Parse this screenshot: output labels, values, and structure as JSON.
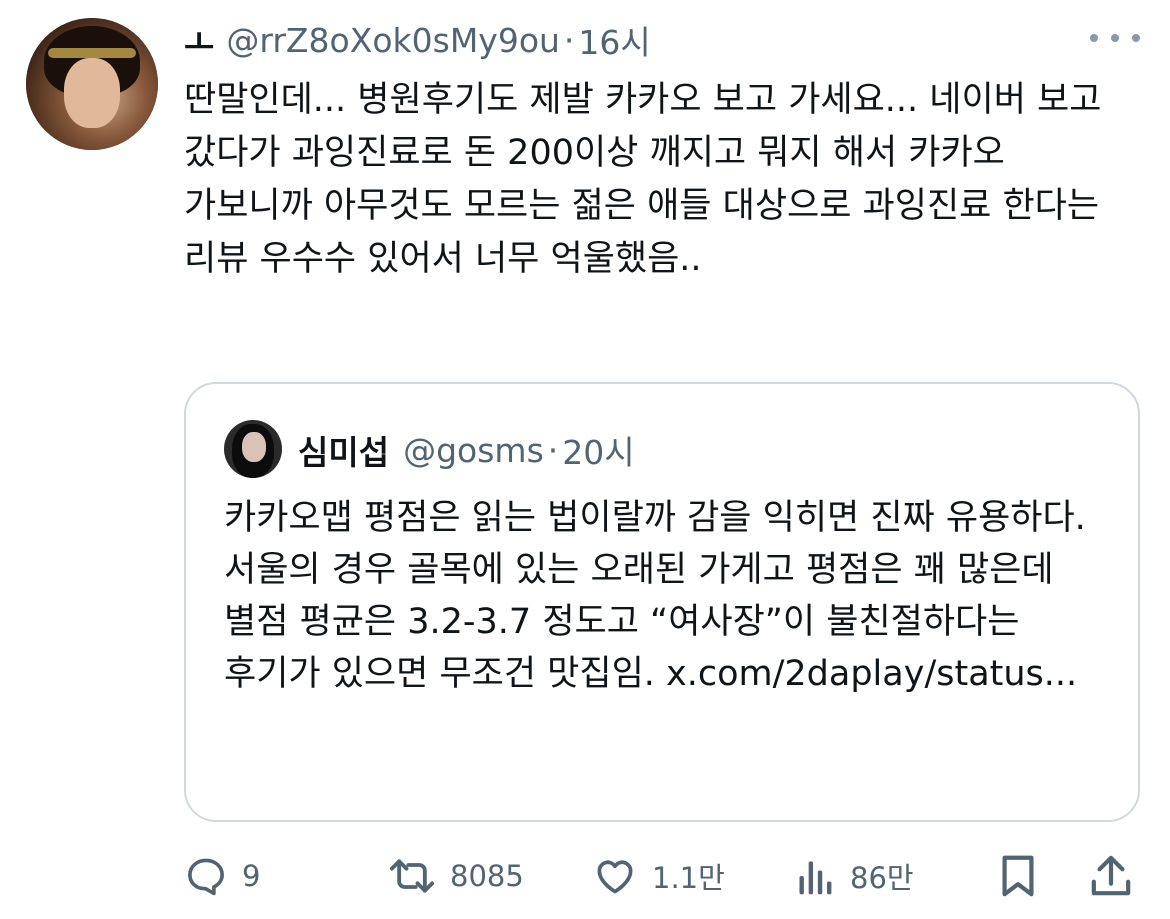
{
  "tweet": {
    "display_name": "ㅗ",
    "handle": "@rrZ8oXok0sMy9ou",
    "dot": "·",
    "time": "16시",
    "text": "딴말인데... 병원후기도 제발 카카오 보고 가세요... 네이버 보고 갔다가 과잉진료로 돈 200이상 깨지고 뭐지 해서 카카오 가보니까 아무것도 모르는 젊은 애들 대상으로 과잉진료 한다는 리뷰 우수수  있어서 너무 억울했음.."
  },
  "quote": {
    "display_name": "심미섭",
    "handle": "@gosms",
    "dot": "·",
    "time": "20시",
    "text": "카카오맵 평점은 읽는 법이랄까 감을 익히면 진짜 유용하다. 서울의 경우 골목에 있는 오래된 가게고 평점은 꽤 많은데 별점 평균은 3.2-3.7 정도고 “여사장”이 불친절하다는 후기가 있으면 무조건 맛집임. x.com/2daplay/status..."
  },
  "actions": {
    "replies": "9",
    "retweets": "8085",
    "likes": "1.1만",
    "views": "86만"
  },
  "icons": {
    "reply": "reply-icon",
    "retweet": "retweet-icon",
    "like": "heart-icon",
    "views": "views-icon",
    "bookmark": "bookmark-icon",
    "share": "share-icon",
    "more": "more-icon"
  },
  "colors": {
    "text": "#0f1419",
    "secondary": "#536471",
    "border": "#cfd9de"
  }
}
